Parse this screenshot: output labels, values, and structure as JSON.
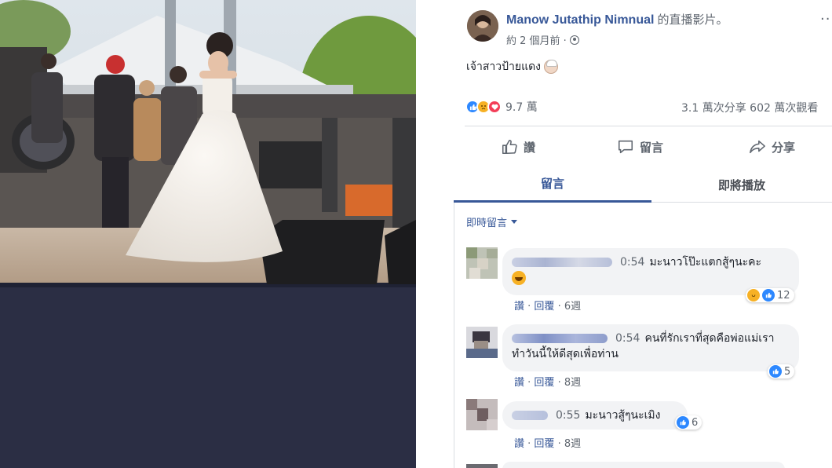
{
  "colors": {
    "link": "#385898",
    "muted": "#606770",
    "bubble": "#f2f3f5",
    "like": "#2d88ff",
    "love": "#f33e58"
  },
  "post": {
    "author": "Manow Jutathip Nimnual",
    "author_suffix": "的直播影片。",
    "time": "約 2 個月前 ·",
    "privacy_icon": "globe-icon",
    "caption": "เจ้าสาวป้ายแดง"
  },
  "reactions": {
    "icons": [
      "like-icon",
      "sad-icon",
      "love-icon"
    ],
    "count": "9.7 萬",
    "stats": "3.1 萬次分享  602 萬次觀看"
  },
  "actions": {
    "like": "讚",
    "comment": "留言",
    "share": "分享"
  },
  "tabs": {
    "comments": "留言",
    "up_next": "即將播放"
  },
  "filter": {
    "label": "即時留言"
  },
  "comments": [
    {
      "time": "0:54",
      "text": "มะนาวโป๊ะแตกสู้ๆนะคะ",
      "reaction_count": "12",
      "links": {
        "like": "讚",
        "reply": "回覆",
        "age": "6週"
      }
    },
    {
      "time": "0:54",
      "text": "คนที่รักเราที่สุดคือพ่อแม่เรา ทำวันนี้ให้ดีสุดเพื่อท่าน",
      "reaction_count": "5",
      "links": {
        "like": "讚",
        "reply": "回覆",
        "age": "8週"
      }
    },
    {
      "time": "0:55",
      "text": "มะนาวสู้ๆนะเมิง",
      "reaction_count": "6",
      "links": {
        "like": "讚",
        "reply": "回覆",
        "age": "8週"
      }
    }
  ]
}
